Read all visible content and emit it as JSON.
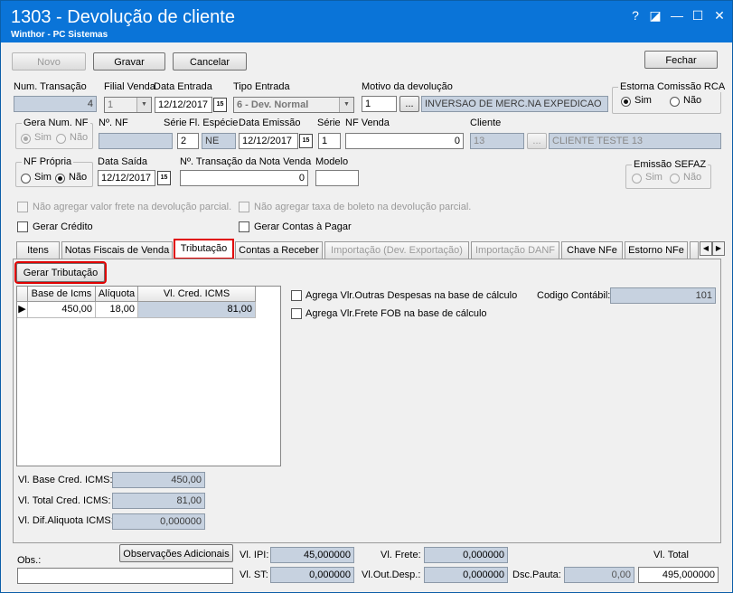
{
  "window": {
    "title": "1303 - Devolução de cliente",
    "subtitle": "Winthor - PC Sistemas",
    "help_glyph": "?",
    "restore_glyph": "◪",
    "minimize_glyph": "—",
    "maximize_glyph": "☐",
    "close_glyph": "✕"
  },
  "toolbar": {
    "novo": "Novo",
    "gravar": "Gravar",
    "cancelar": "Cancelar",
    "fechar": "Fechar"
  },
  "header": {
    "num_transacao_label": "Num. Transação",
    "num_transacao_value": "4",
    "filial_venda_label": "Filial Venda",
    "filial_venda_value": "1",
    "data_entrada_label": "Data Entrada",
    "data_entrada_value": "12/12/2017",
    "tipo_entrada_label": "Tipo Entrada",
    "tipo_entrada_value": "6 - Dev. Normal",
    "motivo_label": "Motivo da devolução",
    "motivo_code": "1",
    "motivo_desc": "INVERSAO DE MERC.NA EXPEDICAO",
    "estorna_label": "Estorna Comissão RCA",
    "estorna_sim": "Sim",
    "estorna_nao": "Não",
    "gera_num_nf_label": "Gera Num. NF",
    "gera_sim": "Sim",
    "gera_nao": "Não",
    "num_nf_label": "Nº. NF",
    "num_nf_value": "",
    "serie_label": "Série",
    "serie_value": "2",
    "fl_especie_label": "Fl. Espécie",
    "fl_especie_value": "NE",
    "data_emissao_label": "Data Emissão",
    "data_emissao_value": "12/12/2017",
    "serie2_label": "Série",
    "serie2_value": "1",
    "nf_venda_label": "NF Venda",
    "nf_venda_value": "0",
    "cliente_label": "Cliente",
    "cliente_code": "13",
    "cliente_name": "CLIENTE TESTE 13",
    "nf_propria_label": "NF Própria",
    "nf_propria_sim": "Sim",
    "nf_propria_nao": "Não",
    "data_saida_label": "Data Saída",
    "data_saida_value": "12/12/2017",
    "num_transacao_nota_label": "Nº. Transação da Nota Venda",
    "num_transacao_nota_value": "0",
    "modelo_label": "Modelo",
    "modelo_value": "",
    "emissao_sefaz_label": "Emissão SEFAZ",
    "emissao_sim": "Sim",
    "emissao_nao": "Não",
    "ellipsis": "...",
    "calendar_glyph": "15",
    "dropdown_glyph": "▼"
  },
  "options": {
    "nao_agregar_frete": "Não agregar valor frete na devolução parcial.",
    "nao_agregar_taxa": "Não agregar taxa de boleto na devolução parcial.",
    "gerar_credito": "Gerar Crédito",
    "gerar_contas": "Gerar Contas à Pagar"
  },
  "tabs": [
    {
      "label": "Itens"
    },
    {
      "label": "Notas Fiscais de Venda"
    },
    {
      "label": "Tributação"
    },
    {
      "label": "Contas a Receber"
    },
    {
      "label": "Importação (Dev. Exportação)"
    },
    {
      "label": "Importação DANF"
    },
    {
      "label": "Chave NFe"
    },
    {
      "label": "Estorno NFe"
    },
    {
      "label": ""
    }
  ],
  "tab_nav": {
    "prev": "◀",
    "next": "▶"
  },
  "tributacao": {
    "gerar_button": "Gerar Tributação",
    "columns": [
      "Base de Icms",
      "Alíquota",
      "Vl. Cred. ICMS"
    ],
    "rows": [
      [
        "450,00",
        "18,00",
        "81,00"
      ]
    ],
    "row_indicator": "▶",
    "agrega_outras": "Agrega Vlr.Outras Despesas na base de cálculo",
    "agrega_frete": "Agrega Vlr.Frete FOB na base de cálculo",
    "codigo_contabil_label": "Codigo Contábil:",
    "codigo_contabil_value": "101",
    "vl_base_label": "Vl. Base Cred. ICMS:",
    "vl_base_value": "450,00",
    "vl_total_label": "Vl. Total Cred. ICMS:",
    "vl_total_value": "81,00",
    "vl_dif_label": "Vl. Dif.Aliquota ICMS:",
    "vl_dif_value": "0,000000"
  },
  "footer": {
    "obs_label": "Obs.:",
    "obs_value": "",
    "observacoes_button": "Observações Adicionais",
    "vl_ipi_label": "Vl. IPI:",
    "vl_ipi_value": "45,000000",
    "vl_st_label": "Vl. ST:",
    "vl_st_value": "0,000000",
    "vl_frete_label": "Vl. Frete:",
    "vl_frete_value": "0,000000",
    "vl_out_label": "Vl.Out.Desp.:",
    "vl_out_value": "0,000000",
    "dsc_pauta_label": "Dsc.Pauta:",
    "dsc_pauta_value": "0,00",
    "vl_total_label": "Vl. Total",
    "vl_total_value": "495,000000"
  }
}
